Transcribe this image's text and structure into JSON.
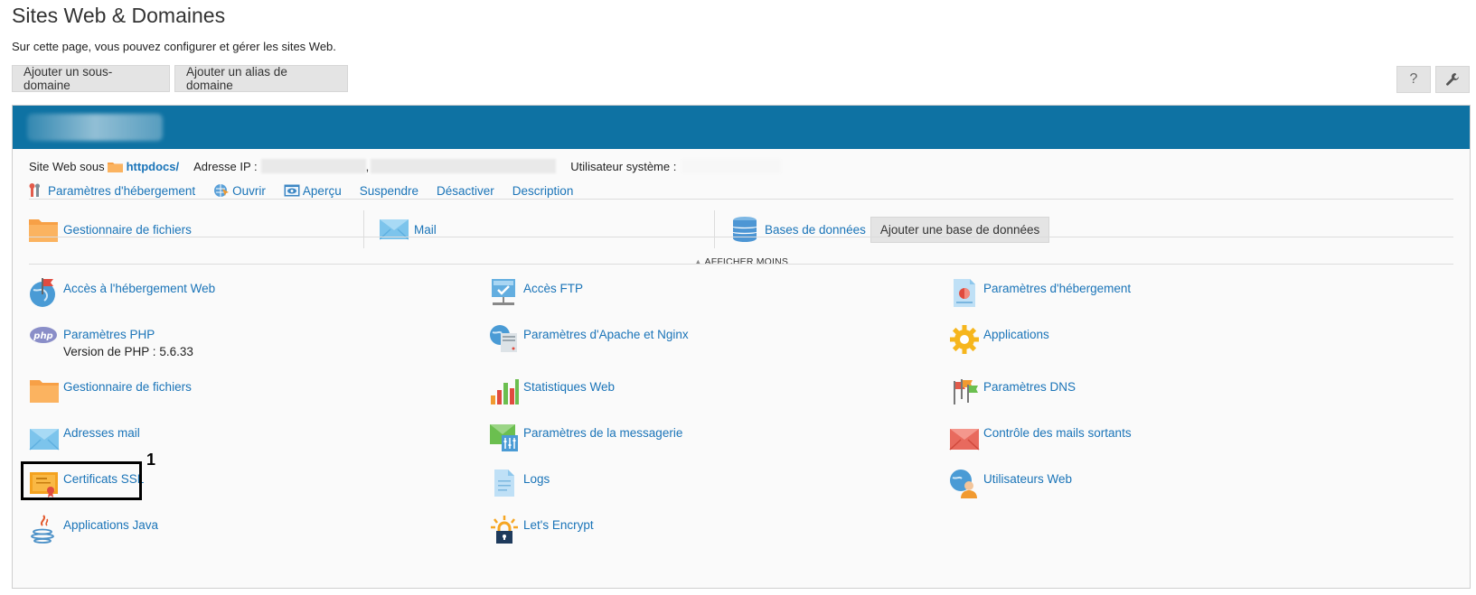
{
  "page": {
    "title": "Sites Web & Domaines",
    "description": "Sur cette page, vous pouvez configurer et gérer les sites Web."
  },
  "toolbar": {
    "add_subdomain": "Ajouter un sous-domaine",
    "add_alias": "Ajouter un alias de domaine",
    "help": "?",
    "tools_icon": "wrench-icon"
  },
  "domain": {
    "info_site": "Site Web sous",
    "docroot": "httpdocs/",
    "ip_label": "Adresse IP :",
    "ip_separator": ",",
    "sysuser_label": "Utilisateur système :"
  },
  "actions": [
    {
      "label": "Paramètres d'hébergement",
      "icon": "hosting-settings-icon"
    },
    {
      "label": "Ouvrir",
      "icon": "open-icon"
    },
    {
      "label": "Aperçu",
      "icon": "preview-icon"
    },
    {
      "label": "Suspendre"
    },
    {
      "label": "Désactiver"
    },
    {
      "label": "Description"
    }
  ],
  "quick": {
    "files": "Gestionnaire de fichiers",
    "mail": "Mail",
    "databases": "Bases de données",
    "add_db": "Ajouter une base de données"
  },
  "show_less": "AFFICHER MOINS",
  "tools": [
    {
      "label": "Accès à l'hébergement Web",
      "icon": "globe-flag-icon"
    },
    {
      "label": "Accès FTP",
      "icon": "ftp-icon"
    },
    {
      "label": "Paramètres d'hébergement",
      "icon": "hosting-doc-icon"
    },
    {
      "label": "Paramètres PHP",
      "sub": "Version de PHP : 5.6.33",
      "icon": "php-icon"
    },
    {
      "label": "Paramètres d'Apache et Nginx",
      "icon": "apache-nginx-icon"
    },
    {
      "label": "Applications",
      "icon": "gear-icon"
    },
    {
      "label": "Gestionnaire de fichiers",
      "icon": "folder-icon"
    },
    {
      "label": "Statistiques Web",
      "icon": "bar-stats-icon"
    },
    {
      "label": "Paramètres DNS",
      "icon": "dns-flags-icon"
    },
    {
      "label": "Adresses mail",
      "icon": "envelope-icon"
    },
    {
      "label": "Paramètres de la messagerie",
      "icon": "mail-settings-icon"
    },
    {
      "label": "Contrôle des mails sortants",
      "icon": "red-envelope-icon"
    },
    {
      "label": "Certificats SSL",
      "icon": "certificate-icon"
    },
    {
      "label": "Logs",
      "icon": "logs-icon"
    },
    {
      "label": "Utilisateurs Web",
      "icon": "web-users-icon"
    },
    {
      "label": "Applications Java",
      "icon": "java-icon"
    },
    {
      "label": "Let's Encrypt",
      "icon": "lets-encrypt-icon"
    }
  ],
  "annotation": {
    "number": "1"
  }
}
